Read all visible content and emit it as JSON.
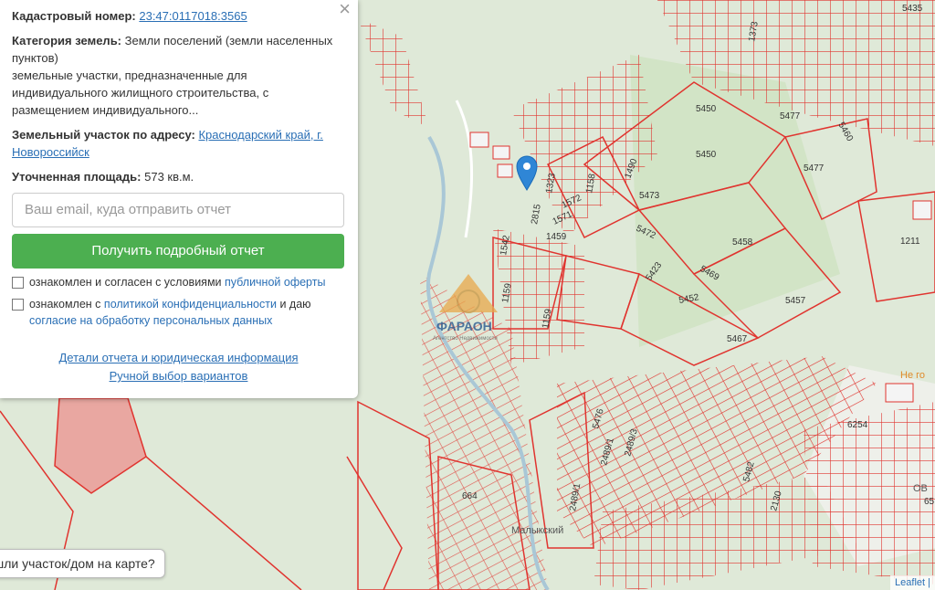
{
  "panel": {
    "cadastral_label": "Кадастровый номер:",
    "cadastral_number": "23:47:0117018:3565",
    "category_label": "Категория земель:",
    "category_value": "Земли поселений (земли населенных пунктов)",
    "category_desc": "земельные участки, предназначенные для индивидуального жилищного строительства, с размещением индивидуального...",
    "address_label": "Земельный участок по адресу:",
    "address_value": "Краснодарский край, г. Новороссийск",
    "area_label": "Уточненная площадь:",
    "area_value": "573 кв.м.",
    "email_placeholder": "Ваш email, куда отправить отчет",
    "report_button": "Получить подробный отчет",
    "consent1_text": "ознакомлен и согласен с условиями",
    "consent1_link": "публичной оферты",
    "consent2_text": "ознакомлен с",
    "consent2_link": "политикой конфиденциальности",
    "consent2_mid": "и даю",
    "consent2_link2": "согласие на обработку персональных данных",
    "details_link": "Детали отчета и юридическая информация",
    "manual_link": "Ручной выбор вариантов",
    "close_icon": "×"
  },
  "map": {
    "bottom_pill": "шли участок/дом на карте?",
    "attribution": "Leaflet",
    "attribution_sep": "|",
    "parcel_labels": [
      "5435",
      "1373",
      "5450",
      "5477",
      "5460",
      "5450",
      "5477",
      "1490",
      "1158",
      "1323",
      "1572",
      "1571",
      "1459",
      "2815",
      "5473",
      "5472",
      "5458",
      "1211",
      "5469",
      "5423",
      "5452",
      "5457",
      "1542",
      "1159",
      "1159",
      "5467",
      "5476",
      "2489/3",
      "2489/1",
      "2489/1",
      "6254",
      "5482",
      "2130",
      "664",
      "65"
    ],
    "place_labels": [
      "Малыкский",
      "Не го",
      "ОВ"
    ],
    "watermark_brand": "ФАРАОН",
    "watermark_sub": "Агентство Недвижимости",
    "marker_icon": "map-pin-icon"
  }
}
